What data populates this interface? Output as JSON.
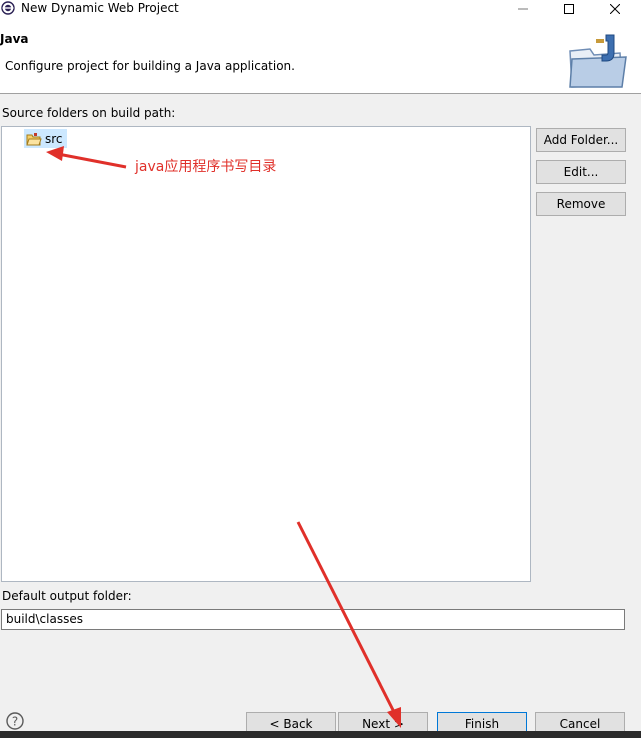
{
  "window": {
    "title": "New Dynamic Web Project"
  },
  "banner": {
    "title": "Java",
    "description": "Configure project for building a Java application."
  },
  "source": {
    "label": "Source folders on build path:",
    "items": [
      {
        "label": "src"
      }
    ],
    "buttons": {
      "add_folder": "Add Folder...",
      "edit": "Edit...",
      "remove": "Remove"
    }
  },
  "output": {
    "label": "Default output folder:",
    "value": "build\\classes"
  },
  "footer": {
    "back": "< Back",
    "next": "Next >",
    "finish": "Finish",
    "cancel": "Cancel"
  },
  "annotation": {
    "text": "java应用程序书写目录",
    "color": "#e0302a"
  }
}
